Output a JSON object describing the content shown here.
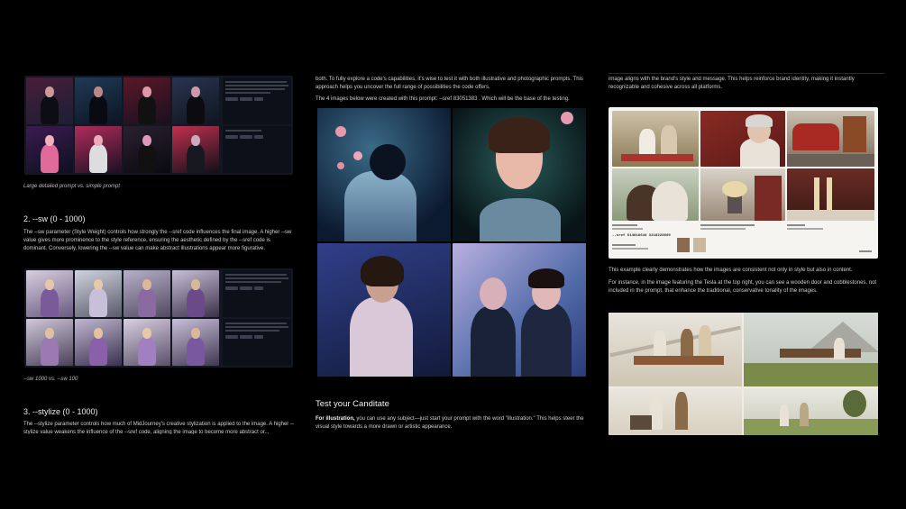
{
  "col1": {
    "caption1": "Large detailed prompt vs. simple prompt",
    "sw_heading": "2. --sw (0 - 1000)",
    "sw_paragraph": "The --sw parameter (Style Weight) controls how strongly the --sref code influences the final image. A higher --sw value gives more prominence to the style reference, ensuring the aesthetic defined by the --sref code is dominant. Conversely, lowering the --sw value can make abstract illustrations appear more figurative.",
    "caption2": "--sw 1000 vs. --sw 100",
    "stylize_heading": "3. --stylize (0 - 1000)",
    "stylize_paragraph": "The --stylize parameter controls how much of MidJourney's creative stylization is applied to the image. A higher --stylize value weakens the influence of the --sref code, aligning the image to become more abstract or..."
  },
  "col2": {
    "intro": "both. To fully explore a code's capabilities, it's wise to test it with both illustrative and photographic prompts. This approach helps you uncover the full range of possibilities the code offers.",
    "images_note": "The 4 images below were created with this prompt: --sref 83051383 . Which will be the base of the testing.",
    "heading": "Test your Canditate",
    "para_lead": "For illustration,",
    "para_rest": " you can use any subject—just start your prompt with the word \"illustration.\" This helps steer the visual style towards a more drawn or artistic appearance."
  },
  "col3": {
    "intro": "image aligns with the brand's style and message. This helps reinforce brand identity, making it instantly recognizable and cohesive across all platforms.",
    "card_code": "--sref 514818644 3218228609",
    "p1": "This example clearly demonstrates how the images are consistent not only in style but also in content.",
    "p2": "For instance, in the image featuring the Tesla at the top right, you can see a wooden door and cobblestones, not included in the prompt, that enhance the traditional, conservative tonality of the images."
  },
  "colors": {
    "background": "#000000",
    "panel": "#121722",
    "card": "#f6f4f1"
  }
}
